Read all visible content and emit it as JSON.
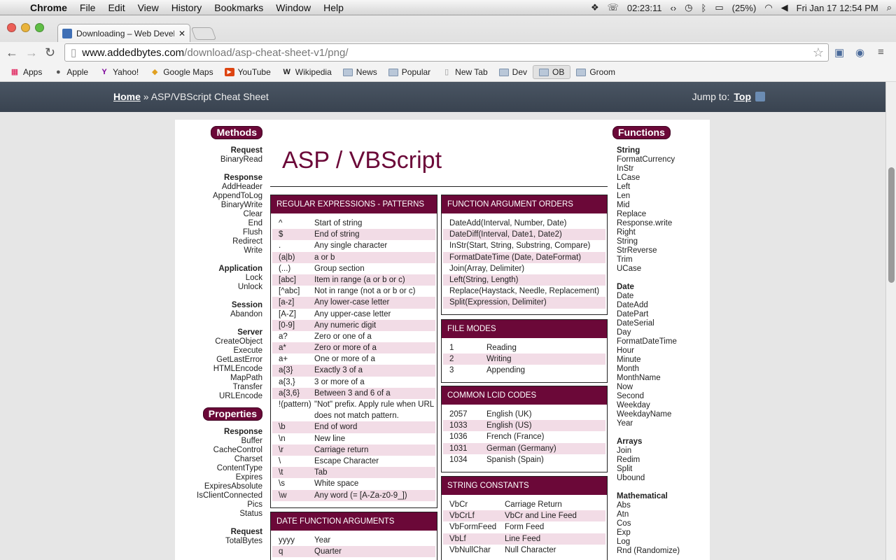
{
  "menubar": {
    "app": "Chrome",
    "items": [
      "File",
      "Edit",
      "View",
      "History",
      "Bookmarks",
      "Window",
      "Help"
    ],
    "timer": "02:23:11",
    "battery": "(25%)",
    "clock": "Fri Jan 17  12:54 PM"
  },
  "browser": {
    "tab_title": "Downloading – Web Develo",
    "url_host": "www.addedbytes.com",
    "url_path": "/download/asp-cheat-sheet-v1/png/",
    "bookmarks": [
      "Apps",
      "Apple",
      "Yahoo!",
      "Google Maps",
      "YouTube",
      "Wikipedia",
      "News",
      "Popular",
      "New Tab",
      "Dev",
      "OB",
      "Groom"
    ]
  },
  "page": {
    "breadcrumb_home": "Home",
    "breadcrumb_sep": " » ",
    "breadcrumb_current": "ASP/VBScript Cheat Sheet",
    "jump_label": "Jump to:",
    "jump_link": "Top"
  },
  "sheet": {
    "title": "ASP / VBScript",
    "methods_label": "Methods",
    "methods": [
      {
        "head": "Request",
        "items": [
          "BinaryRead"
        ]
      },
      {
        "head": "Response",
        "items": [
          "AddHeader",
          "AppendToLog",
          "BinaryWrite",
          "Clear",
          "End",
          "Flush",
          "Redirect",
          "Write"
        ]
      },
      {
        "head": "Application",
        "items": [
          "Lock",
          "Unlock"
        ]
      },
      {
        "head": "Session",
        "items": [
          "Abandon"
        ]
      },
      {
        "head": "Server",
        "items": [
          "CreateObject",
          "Execute",
          "GetLastError",
          "HTMLEncode",
          "MapPath",
          "Transfer",
          "URLEncode"
        ]
      }
    ],
    "properties_label": "Properties",
    "properties": [
      {
        "head": "Response",
        "items": [
          "Buffer",
          "CacheControl",
          "Charset",
          "ContentType",
          "Expires",
          "ExpiresAbsolute",
          "IsClientConnected",
          "Pics",
          "Status"
        ]
      },
      {
        "head": "Request",
        "items": [
          "TotalBytes"
        ]
      }
    ],
    "functions_label": "Functions",
    "functions": [
      {
        "head": "String",
        "items": [
          "FormatCurrency",
          "InStr",
          "LCase",
          "Left",
          "Len",
          "Mid",
          "Replace",
          "Response.write",
          "Right",
          "String",
          "StrReverse",
          "Trim",
          "UCase"
        ]
      },
      {
        "head": "Date",
        "items": [
          "Date",
          "DateAdd",
          "DatePart",
          "DateSerial",
          "Day",
          "FormatDateTime",
          "Hour",
          "Minute",
          "Month",
          "MonthName",
          "Now",
          "Second",
          "Weekday",
          "WeekdayName",
          "Year"
        ]
      },
      {
        "head": "Arrays",
        "items": [
          "Join",
          "Redim",
          "Split",
          "Ubound"
        ]
      },
      {
        "head": "Mathematical",
        "items": [
          "Abs",
          "Atn",
          "Cos",
          "Exp",
          "Log",
          "Rnd (Randomize)"
        ]
      }
    ],
    "regex": {
      "title": "REGULAR EXPRESSIONS - PATTERNS",
      "rows": [
        [
          "^",
          "Start of string"
        ],
        [
          "$",
          "End of string"
        ],
        [
          ".",
          "Any single character"
        ],
        [
          "(a|b)",
          "a or b"
        ],
        [
          "(...)",
          "Group section"
        ],
        [
          "[abc]",
          "Item in range (a or b or c)"
        ],
        [
          "[^abc]",
          "Not in range (not a or b or c)"
        ],
        [
          "[a-z]",
          "Any lower-case letter"
        ],
        [
          "[A-Z]",
          "Any upper-case letter"
        ],
        [
          "[0-9]",
          "Any numeric digit"
        ],
        [
          "a?",
          "Zero or one of a"
        ],
        [
          "a*",
          "Zero or more of a"
        ],
        [
          "a+",
          "One or more of a"
        ],
        [
          "a{3}",
          "Exactly 3 of a"
        ],
        [
          "a{3,}",
          "3 or more of a"
        ],
        [
          "a{3,6}",
          "Between 3 and 6 of a"
        ],
        [
          "!(pattern)",
          "\"Not\" prefix. Apply rule when URL does not match pattern."
        ],
        [
          "\\b",
          "End of word"
        ],
        [
          "\\n",
          "New line"
        ],
        [
          "\\r",
          "Carriage return"
        ],
        [
          "\\",
          "Escape Character"
        ],
        [
          "\\t",
          "Tab"
        ],
        [
          "\\s",
          "White space"
        ],
        [
          "\\w",
          "Any word (= [A-Za-z0-9_])"
        ]
      ]
    },
    "date_args": {
      "title": "DATE FUNCTION ARGUMENTS",
      "rows": [
        [
          "yyyy",
          "Year"
        ],
        [
          "q",
          "Quarter"
        ]
      ]
    },
    "func_args": {
      "title": "FUNCTION ARGUMENT ORDERS",
      "rows": [
        "DateAdd(Interval, Number, Date)",
        "DateDiff(Interval, Date1, Date2)",
        "InStr(Start, String, Substring, Compare)",
        "FormatDateTime (Date, DateFormat)",
        "Join(Array, Delimiter)",
        "Left(String, Length)",
        "Replace(Haystack, Needle, Replacement)",
        "Split(Expression, Delimiter)"
      ]
    },
    "file_modes": {
      "title": "FILE MODES",
      "rows": [
        [
          "1",
          "Reading"
        ],
        [
          "2",
          "Writing"
        ],
        [
          "3",
          "Appending"
        ]
      ]
    },
    "lcid": {
      "title": "COMMON LCID CODES",
      "rows": [
        [
          "2057",
          "English (UK)"
        ],
        [
          "1033",
          "English (US)"
        ],
        [
          "1036",
          "French (France)"
        ],
        [
          "1031",
          "German (Germany)"
        ],
        [
          "1034",
          "Spanish (Spain)"
        ]
      ]
    },
    "string_constants": {
      "title": "STRING CONSTANTS",
      "rows": [
        [
          "VbCr",
          "Carriage Return"
        ],
        [
          "VbCrLf",
          "VbCr and Line Feed"
        ],
        [
          "VbFormFeed",
          "Form Feed"
        ],
        [
          "VbLf",
          "Line Feed"
        ],
        [
          "VbNullChar",
          "Null Character"
        ]
      ]
    }
  },
  "colors": {
    "accent": "#6b0838",
    "stripe": "#f2dce6",
    "topbar": "#424c59"
  }
}
